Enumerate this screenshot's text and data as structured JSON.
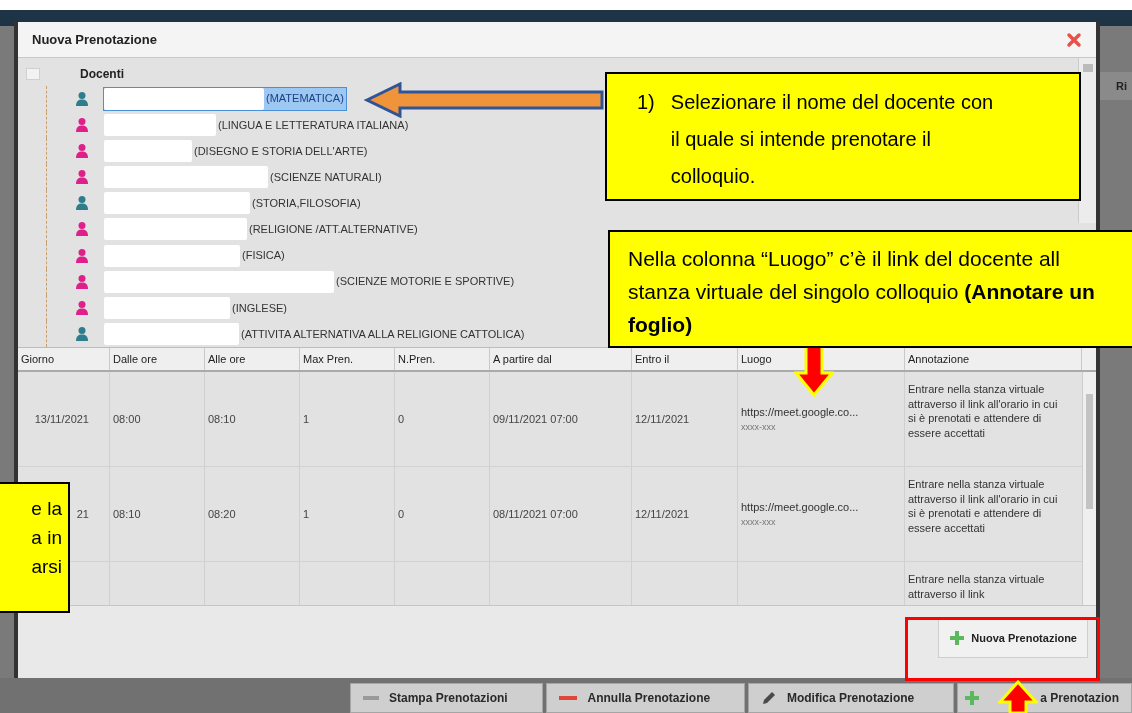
{
  "backdrop": {
    "side_label": "Ri"
  },
  "dialog": {
    "title": "Nuova Prenotazione"
  },
  "tree": {
    "root": "Docenti",
    "items": [
      {
        "kind": "male",
        "subject": "(MATEMATICA)",
        "selected": true
      },
      {
        "kind": "female",
        "subject": "(LINGUA E LETTERATURA ITALIANA)",
        "selected": false
      },
      {
        "kind": "female",
        "subject": "(DISEGNO E STORIA DELL'ARTE)",
        "selected": false
      },
      {
        "kind": "female",
        "subject": "(SCIENZE NATURALI)",
        "selected": false
      },
      {
        "kind": "male",
        "subject": "(STORIA,FILOSOFIA)",
        "selected": false
      },
      {
        "kind": "female",
        "subject": "(RELIGIONE /ATT.ALTERNATIVE)",
        "selected": false
      },
      {
        "kind": "female",
        "subject": "(FISICA)",
        "selected": false
      },
      {
        "kind": "female",
        "subject": "(SCIENZE MOTORIE E SPORTIVE)",
        "selected": false
      },
      {
        "kind": "female",
        "subject": "(INGLESE)",
        "selected": false
      },
      {
        "kind": "male",
        "subject": "(ATTIVITA ALTERNATIVA ALLA RELIGIONE CATTOLICA)",
        "selected": false
      }
    ]
  },
  "table": {
    "columns": [
      "Giorno",
      "Dalle ore",
      "Alle ore",
      "Max Pren.",
      "N.Pren.",
      "A partire dal",
      "Entro il",
      "Luogo",
      "Annotazione"
    ],
    "rows": [
      {
        "giorno": "13/11/2021",
        "dalle": "08:00",
        "alle": "08:10",
        "max": "1",
        "n": "0",
        "dal": "09/11/2021 07:00",
        "entro": "12/11/2021",
        "luogo": "https://meet.google.co...",
        "luogo_code": "xxxx-xxx",
        "annotazione": "Entrare nella stanza virtuale attraverso il link all'orario in cui si è prenotati e attendere di essere accettati"
      },
      {
        "giorno": "21",
        "dalle": "08:10",
        "alle": "08:20",
        "max": "1",
        "n": "0",
        "dal": "08/11/2021 07:00",
        "entro": "12/11/2021",
        "luogo": "https://meet.google.co...",
        "luogo_code": "xxxx-xxx",
        "annotazione": "Entrare nella stanza virtuale attraverso il link all'orario in cui si è prenotati e attendere di essere accettati"
      },
      {
        "annotazione": "Entrare nella stanza virtuale attraverso il link"
      }
    ]
  },
  "footer_button": "Nuova Prenotazione",
  "toolbar": [
    {
      "kind": "print",
      "label": "Stampa Prenotazioni"
    },
    {
      "kind": "remove",
      "label": "Annulla Prenotazione"
    },
    {
      "kind": "edit",
      "label": "Modifica Prenotazione"
    },
    {
      "kind": "add",
      "label": "a Prenotazion"
    }
  ],
  "callouts": [
    {
      "kind": "numbered",
      "number": "1)",
      "text": "Selezionare il nome del docente con il quale si intende prenotare il colloquio."
    },
    {
      "kind": "plain",
      "text": "Nella colonna “Luogo” c’è il link del docente all stanza virtuale del singolo colloquio **(Annotare un foglio)**"
    },
    {
      "kind": "lines",
      "lines": [
        "e la",
        "a in",
        "arsi"
      ]
    }
  ]
}
